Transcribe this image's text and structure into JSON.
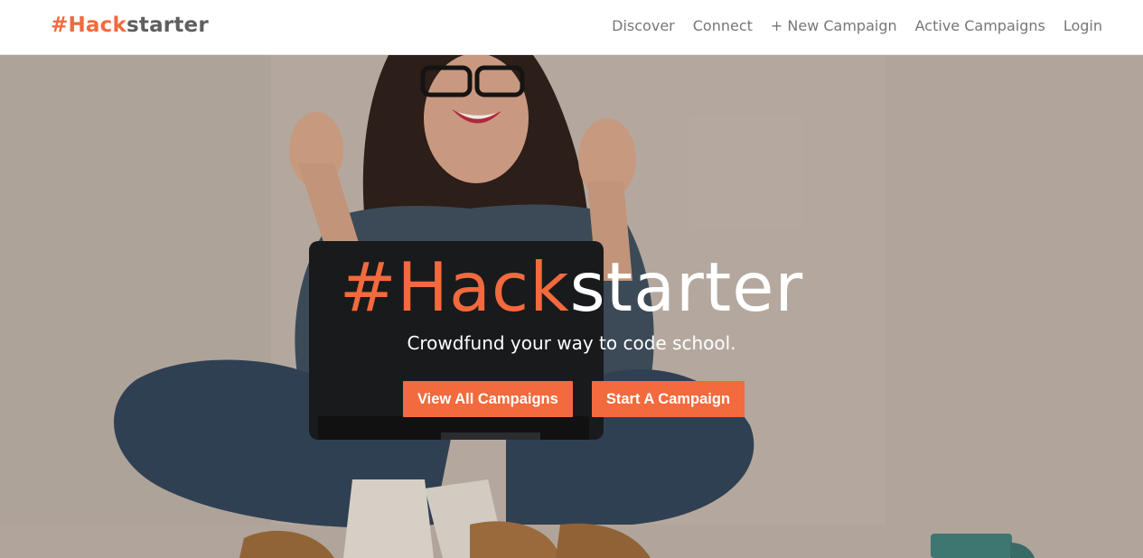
{
  "navbar": {
    "brand_accent": "#Hack",
    "brand_rest": "starter",
    "links": [
      {
        "label": "Discover"
      },
      {
        "label": "Connect"
      },
      {
        "label": "+ New Campaign"
      },
      {
        "label": "Active Campaigns"
      },
      {
        "label": "Login"
      }
    ]
  },
  "hero": {
    "title_accent": "#Hack",
    "title_rest": "starter",
    "subtitle": "Crowdfund your way to code school.",
    "buttons": [
      {
        "label": "View All Campaigns"
      },
      {
        "label": "Start A Campaign"
      }
    ]
  },
  "colors": {
    "accent": "#f26a3d",
    "nav_text": "#777777",
    "brand_gray": "#5f5f5f"
  }
}
